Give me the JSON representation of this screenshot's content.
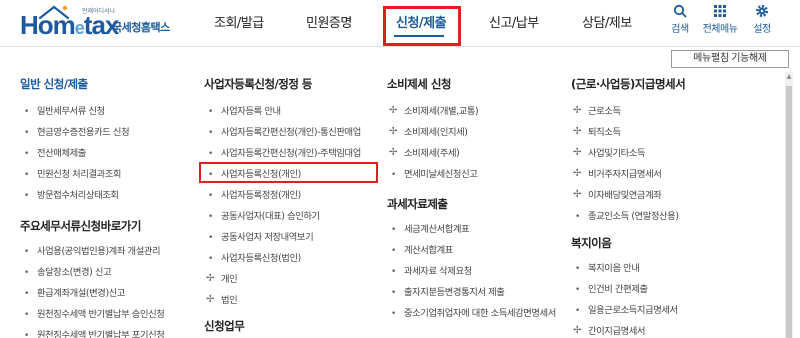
{
  "brand": {
    "tagline": "언제어디서나",
    "word_home": "Hom",
    "word_e": "e",
    "word_tax": "tax",
    "subtitle": "국세청홈택스"
  },
  "gnb": {
    "items": [
      {
        "label": "조회/발급"
      },
      {
        "label": "민원증명"
      },
      {
        "label": "신청/제출"
      },
      {
        "label": "신고/납부"
      },
      {
        "label": "상담/제보"
      }
    ],
    "active_index": 2
  },
  "util": {
    "search": "검색",
    "all_menu": "전체메뉴",
    "settings": "설정"
  },
  "release_button": "메뉴펼침 기능해제",
  "columns": [
    {
      "title": "일반 신청/제출",
      "items": [
        "일반세무서류 신청",
        "현금영수증전용카드 신청",
        "전산매체제출",
        "민원신청 처리결과조회",
        "방문접수처리상태조회"
      ],
      "sub_title": "주요세무서류신청바로가기",
      "sub_items": [
        "사업용(공익법인용)계좌 개설관리",
        "송달장소(변경) 신고",
        "환급계좌개설(변경)신고",
        "원천징수세액 반기별납부 승인신청",
        "원천징수세액 반기별납부 포기신청"
      ]
    },
    {
      "title": "사업자등록신청/정정 등",
      "items": [
        "사업자등록 안내",
        "사업자등록간편신청(개인)-통신판매업",
        "사업자등록간편신청(개인)-주택임대업",
        "사업자등록신청(개인)",
        "사업자등록정정(개인)",
        "공동사업자(대표) 승인하기",
        "공동사업자 저장내역보기",
        "사업자등록신청(법인)"
      ],
      "plus_items": [
        "개인",
        "법인"
      ],
      "sub_title": "신청업무"
    },
    {
      "title": "소비제세 신청",
      "plus_items": [
        "소비제세(개별,교통)",
        "소비제세(인지세)",
        "소비제세(주세)"
      ],
      "items_after": [
        "면세미날세신청신고"
      ],
      "sub_title": "과세자료제출",
      "sub_items": [
        "세금계산서합계표",
        "계산서합계표",
        "과세자료 삭제요청",
        "출자지분등변경통지서 제출",
        "중소기업취업자에 대한 소득세감면명세서"
      ]
    },
    {
      "title": "(근로·사업등)지급명세서",
      "plus_items": [
        "근로소득",
        "퇴직소득",
        "사업및기타소득",
        "비거주자지급명세서",
        "이자배당및연금계좌"
      ],
      "items_after": [
        "종교인소득 (연말정산용)"
      ],
      "sub_title": "복지이음",
      "sub_items": [
        "복지이음 안내",
        "인건비 간편제출",
        "일용근로소득지급명세서"
      ],
      "sub_plus": [
        "간이지급명세서"
      ]
    }
  ],
  "colors": {
    "brand_blue": "#1d5a9e",
    "highlight_red": "#e02020"
  }
}
